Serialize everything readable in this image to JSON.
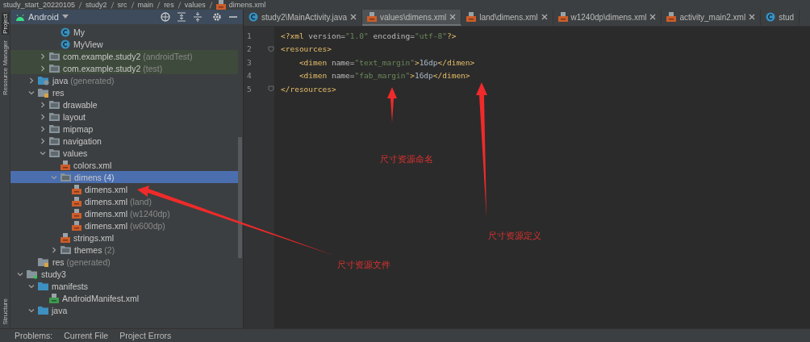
{
  "breadcrumb": [
    "study_start_20220105",
    "study2",
    "src",
    "main",
    "res",
    "values",
    "dimens.xml"
  ],
  "side_tabs_top": [
    {
      "label": "Project",
      "selected": true
    },
    {
      "label": "Resource Manager",
      "selected": false
    }
  ],
  "side_tabs_bottom": [
    {
      "label": "Structure",
      "selected": false
    }
  ],
  "project_panel": {
    "view": "Android",
    "tree": [
      {
        "children": [
          {
            "children": [
              {
                "children": [
                  {
                    "label": "My",
                    "kind": "class",
                    "selected": false
                  },
                  {
                    "label": "MyView",
                    "kind": "class",
                    "selected": false
                  }
                ]
              },
              {
                "label": "com.example.study2",
                "note": "(androidTest)",
                "kind": "test-folder",
                "expanded": false,
                "selected": false
              },
              {
                "label": "com.example.study2",
                "note": "(test)",
                "kind": "test-folder",
                "expanded": false,
                "selected": false
              }
            ]
          },
          {
            "label": "java",
            "note": "(generated)",
            "kind": "gen-folder",
            "expanded": false,
            "selected": false
          },
          {
            "label": "res",
            "kind": "res-folder",
            "expanded": true,
            "selected": false,
            "children": [
              {
                "label": "drawable",
                "kind": "folder",
                "expanded": false,
                "selected": false
              },
              {
                "label": "layout",
                "kind": "folder",
                "expanded": false,
                "selected": false
              },
              {
                "label": "mipmap",
                "kind": "folder",
                "expanded": false,
                "selected": false
              },
              {
                "label": "navigation",
                "kind": "folder",
                "expanded": false,
                "selected": false
              },
              {
                "label": "values",
                "kind": "folder",
                "expanded": true,
                "selected": false,
                "children": [
                  {
                    "label": "colors.xml",
                    "kind": "xml",
                    "selected": false
                  },
                  {
                    "label": "dimens",
                    "note": "(4)",
                    "kind": "folder",
                    "expanded": true,
                    "selected": true,
                    "children": [
                      {
                        "label": "dimens.xml",
                        "kind": "xml",
                        "selected": false
                      },
                      {
                        "label": "dimens.xml",
                        "note": "(land)",
                        "kind": "xml",
                        "selected": false
                      },
                      {
                        "label": "dimens.xml",
                        "note": "(w1240dp)",
                        "kind": "xml",
                        "selected": false
                      },
                      {
                        "label": "dimens.xml",
                        "note": "(w600dp)",
                        "kind": "xml",
                        "selected": false
                      }
                    ]
                  },
                  {
                    "label": "strings.xml",
                    "kind": "xml",
                    "selected": false
                  },
                  {
                    "label": "themes",
                    "note": "(2)",
                    "kind": "folder",
                    "expanded": false,
                    "selected": false
                  }
                ]
              }
            ]
          },
          {
            "label": "res",
            "note": "(generated)",
            "kind": "gen-res-folder",
            "selected": false
          }
        ]
      },
      {
        "label": "study3",
        "kind": "module",
        "expanded": true,
        "selected": false,
        "children": [
          {
            "label": "manifests",
            "kind": "blue-folder",
            "expanded": true,
            "selected": false,
            "children": [
              {
                "label": "AndroidManifest.xml",
                "kind": "manifest",
                "selected": false
              }
            ]
          },
          {
            "label": "java",
            "kind": "blue-folder",
            "expanded": true,
            "selected": false
          }
        ]
      }
    ]
  },
  "editor": {
    "tabs": [
      {
        "label": "study2\\MainActivity.java",
        "kind": "class",
        "selected": false,
        "closable": true
      },
      {
        "label": "values\\dimens.xml",
        "kind": "xml",
        "selected": true,
        "closable": true
      },
      {
        "label": "land\\dimens.xml",
        "kind": "xml",
        "selected": false,
        "closable": true
      },
      {
        "label": "w1240dp\\dimens.xml",
        "kind": "xml",
        "selected": false,
        "closable": true
      },
      {
        "label": "activity_main2.xml",
        "kind": "xml",
        "selected": false,
        "closable": true
      },
      {
        "label": "stud",
        "kind": "class",
        "selected": false,
        "closable": false
      }
    ],
    "lines": [
      {
        "number": "1",
        "fold": false,
        "tokens": [
          {
            "t": "<?xml",
            "kind": "tag"
          },
          {
            "t": " version=",
            "kind": "attr"
          },
          {
            "t": "\"1.0\"",
            "kind": "value"
          },
          {
            "t": " encoding=",
            "kind": "attr"
          },
          {
            "t": "\"utf-8\"",
            "kind": "value"
          },
          {
            "t": "?>",
            "kind": "tag"
          }
        ]
      },
      {
        "number": "2",
        "fold": true,
        "tokens": [
          {
            "t": "<resources>",
            "kind": "tag"
          }
        ]
      },
      {
        "number": "3",
        "fold": false,
        "tokens": [
          {
            "t": "    <dimen",
            "kind": "tag"
          },
          {
            "t": " name=",
            "kind": "attr"
          },
          {
            "t": "\"text_margin\"",
            "kind": "value"
          },
          {
            "t": ">",
            "kind": "tag"
          },
          {
            "t": "16dp",
            "kind": "text"
          },
          {
            "t": "</dimen>",
            "kind": "tag"
          }
        ]
      },
      {
        "number": "4",
        "fold": false,
        "tokens": [
          {
            "t": "    <dimen",
            "kind": "tag"
          },
          {
            "t": " name=",
            "kind": "attr"
          },
          {
            "t": "\"fab_margin\"",
            "kind": "value"
          },
          {
            "t": ">",
            "kind": "tag"
          },
          {
            "t": "16dp",
            "kind": "text"
          },
          {
            "t": "</dimen>",
            "kind": "tag"
          }
        ]
      },
      {
        "number": "5",
        "fold": true,
        "tokens": [
          {
            "t": "</resources>",
            "kind": "tag"
          }
        ]
      }
    ]
  },
  "annotations": [
    {
      "text": "尺寸资源命名"
    },
    {
      "text": "尺寸资源定义"
    },
    {
      "text": "尺寸资源文件"
    }
  ],
  "bottom_bar": {
    "tabs": [
      {
        "label": "Problems:",
        "selected": false
      },
      {
        "label": "Current File",
        "selected": false
      },
      {
        "label": "Project Errors",
        "selected": false
      }
    ]
  }
}
